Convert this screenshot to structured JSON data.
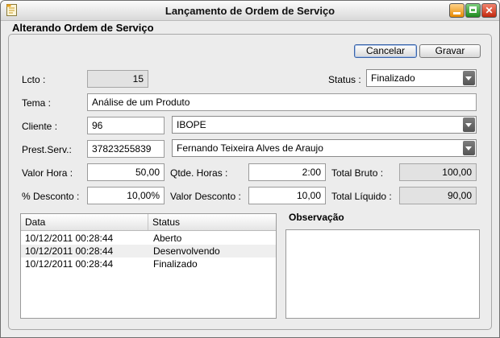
{
  "window": {
    "title": "Lançamento de Ordem de Serviço",
    "icon": "form-icon",
    "controls": [
      "minimize-icon",
      "maximize-icon",
      "close-icon"
    ]
  },
  "form": {
    "group_title": "Alterando Ordem de Serviço",
    "buttons": {
      "cancel": "Cancelar",
      "save": "Gravar"
    },
    "lcto": {
      "label": "Lcto :",
      "value": "15"
    },
    "status": {
      "label": "Status :",
      "value": "Finalizado"
    },
    "tema": {
      "label": "Tema :",
      "value": "Análise de um Produto"
    },
    "cliente": {
      "label": "Cliente :",
      "code": "96",
      "name": "IBOPE"
    },
    "prest": {
      "label": "Prest.Serv.:",
      "code": "37823255839",
      "name": "Fernando Teixeira Alves de Araujo"
    },
    "valor_hora": {
      "label": "Valor Hora :",
      "value": "50,00"
    },
    "qtde_horas": {
      "label": "Qtde. Horas :",
      "value": "2:00"
    },
    "total_bruto": {
      "label": "Total Bruto :",
      "value": "100,00"
    },
    "desconto": {
      "label": "% Desconto :",
      "value": "10,00%"
    },
    "valor_desconto": {
      "label": "Valor Desconto :",
      "value": "10,00"
    },
    "total_liquido": {
      "label": "Total Líquido :",
      "value": "90,00"
    }
  },
  "history": {
    "columns": [
      "Data",
      "Status"
    ],
    "rows": [
      {
        "date": "10/12/2011 00:28:44",
        "status": "Aberto"
      },
      {
        "date": "10/12/2011 00:28:44",
        "status": "Desenvolvendo"
      },
      {
        "date": "10/12/2011 00:28:44",
        "status": "Finalizado"
      }
    ]
  },
  "observacao": {
    "label": "Observação",
    "value": ""
  }
}
